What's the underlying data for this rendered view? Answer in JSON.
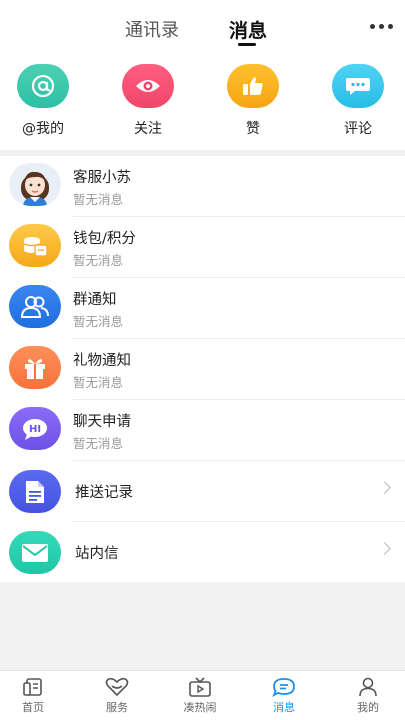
{
  "header": {
    "tabs": [
      {
        "label": "通讯录",
        "active": false
      },
      {
        "label": "消息",
        "active": true
      }
    ],
    "more_icon": "more-horizontal-icon"
  },
  "quick_actions": [
    {
      "label": "@我的",
      "icon": "at-icon",
      "color": "#2cc0a6"
    },
    {
      "label": "关注",
      "icon": "eye-icon",
      "color": "#f0466a"
    },
    {
      "label": "赞",
      "icon": "thumbs-up-icon",
      "color": "#f5a514"
    },
    {
      "label": "评论",
      "icon": "comment-icon",
      "color": "#27bde6"
    }
  ],
  "messages": [
    {
      "title": "客服小苏",
      "subtitle": "暂无消息",
      "icon": "service-avatar"
    },
    {
      "title": "钱包/积分",
      "subtitle": "暂无消息",
      "icon": "wallet-icon"
    },
    {
      "title": "群通知",
      "subtitle": "暂无消息",
      "icon": "group-icon"
    },
    {
      "title": "礼物通知",
      "subtitle": "暂无消息",
      "icon": "gift-icon"
    },
    {
      "title": "聊天申请",
      "subtitle": "暂无消息",
      "icon": "hi-chat-icon"
    }
  ],
  "links": [
    {
      "title": "推送记录",
      "icon": "document-icon"
    },
    {
      "title": "站内信",
      "icon": "mail-icon"
    }
  ],
  "bottom_nav": [
    {
      "label": "首页",
      "icon": "home-icon",
      "active": false
    },
    {
      "label": "服务",
      "icon": "service-heart-icon",
      "active": false
    },
    {
      "label": "凑热闹",
      "icon": "tv-icon",
      "active": false
    },
    {
      "label": "消息",
      "icon": "message-icon",
      "active": true
    },
    {
      "label": "我的",
      "icon": "profile-icon",
      "active": false
    }
  ],
  "colors": {
    "accent": "#1e90e8",
    "background": "#f2f2f2"
  }
}
